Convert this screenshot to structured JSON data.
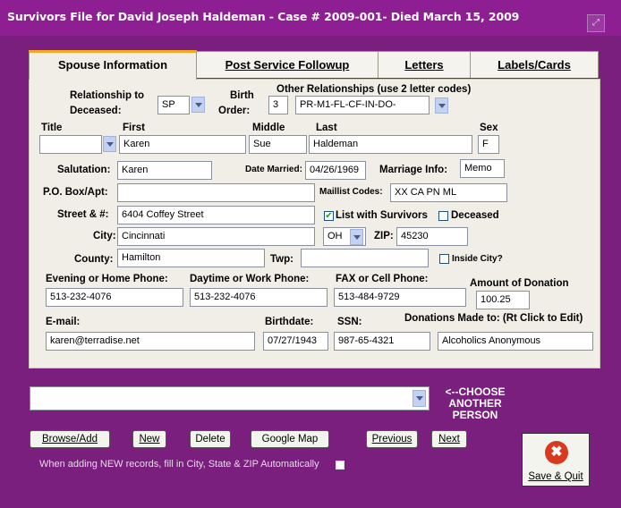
{
  "window": {
    "title": "Survivors File for David Joseph Haldeman - Case # 2009-001- Died March 15, 2009"
  },
  "tabs": [
    {
      "label": "Spouse Information"
    },
    {
      "label": "Post Service Followup"
    },
    {
      "label": "Letters"
    },
    {
      "label": "Labels/Cards"
    }
  ],
  "labels": {
    "relationship1": "Relationship to",
    "relationship2": "Deceased:",
    "birth1": "Birth",
    "birth2": "Order:",
    "other_rel": "Other Relationships (use 2 letter codes)",
    "title": "Title",
    "first": "First",
    "middle": "Middle",
    "last": "Last",
    "sex": "Sex",
    "salutation": "Salutation:",
    "date_married": "Date Married:",
    "marriage_info": "Marriage Info:",
    "po_box": "P.O. Box/Apt:",
    "maillist": "Maillist Codes:",
    "street": "Street & #:",
    "list_survivors": "List with Survivors",
    "deceased": "Deceased",
    "city": "City:",
    "zip": "ZIP:",
    "county": "County:",
    "twp": "Twp:",
    "inside_city": "Inside City?",
    "evening_phone": "Evening or Home Phone:",
    "daytime_phone": "Daytime or Work Phone:",
    "fax_phone": "FAX or Cell Phone:",
    "amount_donation": "Amount of Donation",
    "email": "E-mail:",
    "birthdate": "Birthdate:",
    "ssn": "SSN:",
    "donations_to": "Donations Made to: (Rt Click to Edit)"
  },
  "fields": {
    "relationship": "SP",
    "birth_order": "3",
    "other_relationships": "PR-M1-FL-CF-IN-DO-",
    "title": "",
    "first": "Karen",
    "middle": "Sue",
    "last": "Haldeman",
    "sex": "F",
    "salutation": "Karen",
    "date_married": "04/26/1969",
    "marriage_info": "Memo",
    "po_box": "",
    "maillist_codes": "XX CA PN ML",
    "street": "6404 Coffey Street",
    "city": "Cincinnati",
    "state": "OH",
    "zip": "45230",
    "county": "Hamilton",
    "twp": "",
    "evening_phone": "513-232-4076",
    "daytime_phone": "513-232-4076",
    "fax_phone": "513-484-9729",
    "amount_donation": "100.25",
    "email": "karen@terradise.net",
    "birthdate": "07/27/1943",
    "ssn": "987-65-4321",
    "donations_to": "Alcoholics Anonymous"
  },
  "checkboxes": {
    "list_with_survivors": true,
    "deceased": false,
    "inside_city": false,
    "auto_fill": false
  },
  "person_select": {
    "value": ""
  },
  "choose_label": [
    "<--CHOOSE",
    "ANOTHER",
    "PERSON"
  ],
  "buttons": {
    "browse_add": "Browse/Add",
    "new": "New",
    "delete": "Delete",
    "google_map": "Google Map",
    "previous": "Previous",
    "next": "Next",
    "save_quit": "Save & Quit"
  },
  "hint": "When adding NEW records, fill in City, State & ZIP Automatically"
}
